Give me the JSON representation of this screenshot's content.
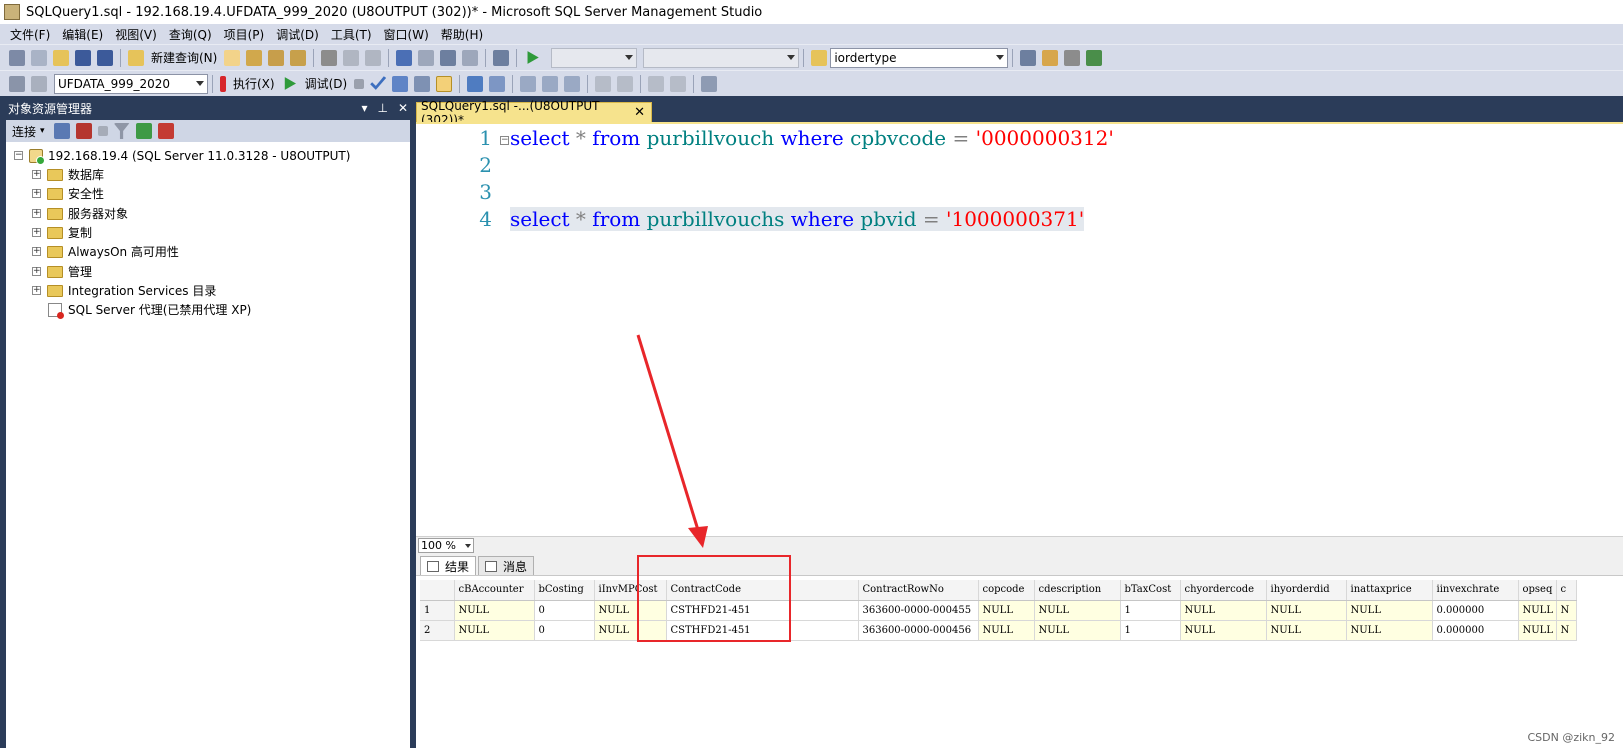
{
  "window": {
    "title": "SQLQuery1.sql - 192.168.19.4.UFDATA_999_2020 (U8OUTPUT (302))* - Microsoft SQL Server Management Studio"
  },
  "menu": [
    "文件(F)",
    "编辑(E)",
    "视图(V)",
    "查询(Q)",
    "项目(P)",
    "调试(D)",
    "工具(T)",
    "窗口(W)",
    "帮助(H)"
  ],
  "toolbar1": {
    "new_query_label": "新建查询(N)",
    "search_value": "iordertype"
  },
  "toolbar2": {
    "database_value": "UFDATA_999_2020",
    "execute_label": "执行(X)",
    "debug_label": "调试(D)"
  },
  "object_explorer": {
    "title": "对象资源管理器",
    "pin_glyph": "▾ ⊥ ✕",
    "connect_label": "连接",
    "server_node": "192.168.19.4 (SQL Server 11.0.3128 - U8OUTPUT)",
    "nodes": [
      "数据库",
      "安全性",
      "服务器对象",
      "复制",
      "AlwaysOn 高可用性",
      "管理",
      "Integration Services 目录"
    ],
    "agent_node": "SQL Server 代理(已禁用代理 XP)"
  },
  "editor": {
    "tab_label": "SQLQuery1.sql -...(U8OUTPUT (302))*",
    "line_numbers": [
      "1",
      "2",
      "3",
      "4"
    ],
    "line1": {
      "kw1": "select",
      "op1": " * ",
      "kw2": "from",
      "table": "purbillvouch",
      "kw3": "where",
      "col": "cpbvcode",
      "op2": " = ",
      "val": "'0000000312'"
    },
    "line4": {
      "kw1": "select",
      "op1": " * ",
      "kw2": "from",
      "table": "purbillvouchs",
      "kw3": "where",
      "col": "pbvid",
      "op2": " = ",
      "val": "'1000000371'"
    },
    "zoom": "100 %"
  },
  "results": {
    "tab_results": "结果",
    "tab_messages": "消息",
    "columns": [
      "cBAccounter",
      "bCosting",
      "iInvMPCost",
      "ContractCode",
      "ContractRowNo",
      "copcode",
      "cdescription",
      "bTaxCost",
      "chyordercode",
      "ihyorderdid",
      "inattaxprice",
      "iinvexchrate",
      "opseq",
      "c"
    ],
    "rows": [
      {
        "n": "1",
        "cells": [
          "NULL",
          "0",
          "NULL",
          "CSTHFD21-451",
          "363600-0000-000455",
          "NULL",
          "NULL",
          "1",
          "NULL",
          "NULL",
          "NULL",
          "0.000000",
          "NULL",
          "N"
        ]
      },
      {
        "n": "2",
        "cells": [
          "NULL",
          "0",
          "NULL",
          "CSTHFD21-451",
          "363600-0000-000456",
          "NULL",
          "NULL",
          "1",
          "NULL",
          "NULL",
          "NULL",
          "0.000000",
          "NULL",
          "N"
        ]
      }
    ]
  },
  "watermark": "CSDN @zikn_92",
  "colors": {
    "chrome": "#2b3c59",
    "toolbar": "#d6dbe9",
    "active_tab": "#f6e38d",
    "annotation": "#e8262a"
  }
}
